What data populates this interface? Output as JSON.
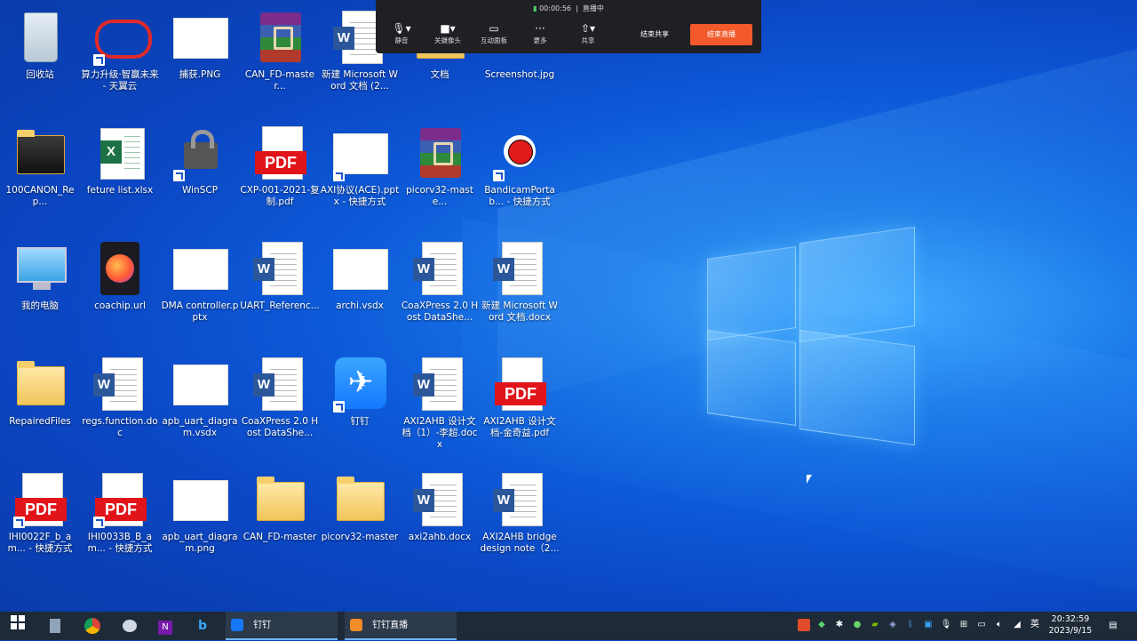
{
  "meeting_bar": {
    "timer": "00:00:56",
    "status": "直播中",
    "buttons": [
      {
        "label": "静音",
        "icon": "microphone-icon"
      },
      {
        "label": "关摄像头",
        "icon": "camera-icon"
      },
      {
        "label": "互动面板",
        "icon": "chat-icon"
      },
      {
        "label": "更多",
        "icon": "more-icon"
      },
      {
        "label": "共享",
        "icon": "share-icon"
      }
    ],
    "end_share": "结束共享",
    "end_live": "结束直播"
  },
  "desktop_icons": [
    {
      "label": "回收站"
    },
    {
      "label": "算力升级·智赢未来 - 天翼云"
    },
    {
      "label": "捕获.PNG"
    },
    {
      "label": "CAN_FD-master..."
    },
    {
      "label": "新建 Microsoft Word 文档 (2..."
    },
    {
      "label": "文档"
    },
    {
      "label": "Screenshot.jpg"
    },
    {
      "label": "100CANON_Rep..."
    },
    {
      "label": "feture list.xlsx"
    },
    {
      "label": "WinSCP"
    },
    {
      "label": "CXP-001-2021-复制.pdf"
    },
    {
      "label": "AXI协议(ACE).pptx - 快捷方式"
    },
    {
      "label": "picorv32-maste..."
    },
    {
      "label": "BandicamPortab... - 快捷方式"
    },
    {
      "label": "我的电脑"
    },
    {
      "label": "coachip.url"
    },
    {
      "label": "DMA controller.pptx"
    },
    {
      "label": "UART_Referenc..."
    },
    {
      "label": "archi.vsdx"
    },
    {
      "label": "CoaXPress 2.0 Host DataShe..."
    },
    {
      "label": "新建 Microsoft Word 文档.docx"
    },
    {
      "label": "RepairedFiles"
    },
    {
      "label": "regs.function.doc"
    },
    {
      "label": "apb_uart_diagram.vsdx"
    },
    {
      "label": "CoaXPress 2.0 Host DataShe..."
    },
    {
      "label": "钉钉"
    },
    {
      "label": "AXI2AHB 设计文档（1）-李超.docx"
    },
    {
      "label": "AXI2AHB 设计文档-金奇益.pdf"
    },
    {
      "label": "IHI0022F_b_am... - 快捷方式"
    },
    {
      "label": "IHI0033B_B_am... - 快捷方式"
    },
    {
      "label": "apb_uart_diagram.png"
    },
    {
      "label": "CAN_FD-master"
    },
    {
      "label": "picorv32-master"
    },
    {
      "label": "axi2ahb.docx"
    },
    {
      "label": "AXI2AHB bridge design note（2..."
    }
  ],
  "taskbar": {
    "apps": [
      {
        "label": "钉钉"
      },
      {
        "label": "钉钉直播"
      }
    ],
    "ime": "英",
    "time": "20:32:59",
    "date": "2023/9/15"
  }
}
